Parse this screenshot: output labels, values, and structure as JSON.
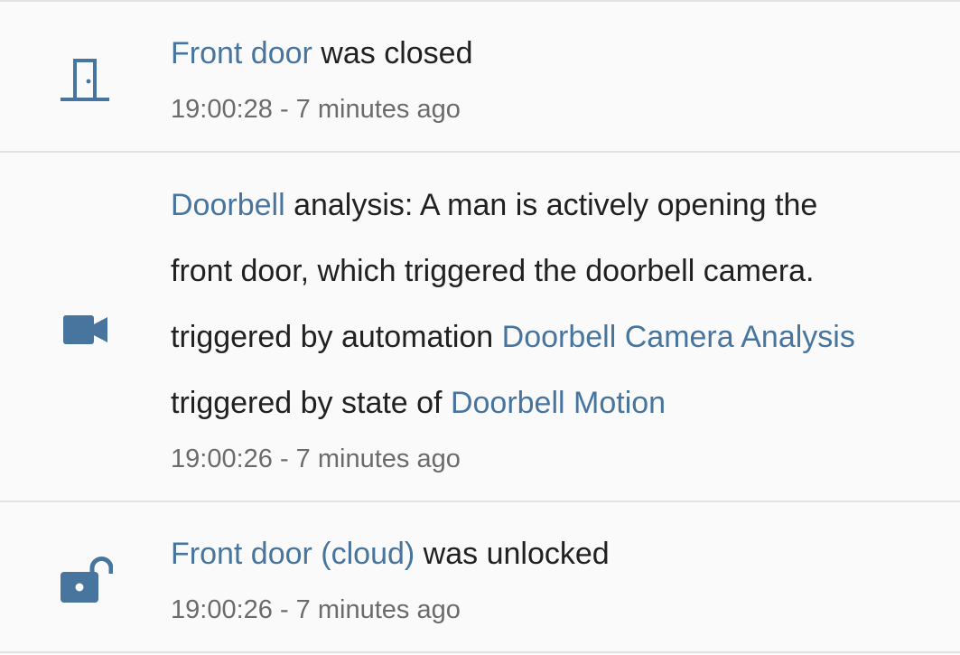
{
  "colors": {
    "background": "#fafafa",
    "text": "#212121",
    "link": "#47759e",
    "secondary": "#6b6b6b",
    "icon": "#47759e",
    "divider": "#e2e2e2"
  },
  "entries": [
    {
      "icon": "door-closed-icon",
      "entity": "Front door",
      "action": " was closed",
      "time": "19:00:28",
      "separator": " - ",
      "relative": "7 minutes ago"
    },
    {
      "icon": "video-camera-icon",
      "entity": "Doorbell",
      "message_line1": " analysis: A man is actively opening the",
      "message_line2": "front door, which triggered the doorbell camera.",
      "trigger1_prefix": "triggered by automation ",
      "trigger1_link": "Doorbell Camera Analysis",
      "trigger2_prefix": "triggered by state of ",
      "trigger2_link": "Doorbell Motion",
      "time": "19:00:26",
      "separator": " - ",
      "relative": "7 minutes ago"
    },
    {
      "icon": "lock-open-icon",
      "entity": "Front door (cloud)",
      "action": " was unlocked",
      "time": "19:00:26",
      "separator": " - ",
      "relative": "7 minutes ago"
    }
  ]
}
